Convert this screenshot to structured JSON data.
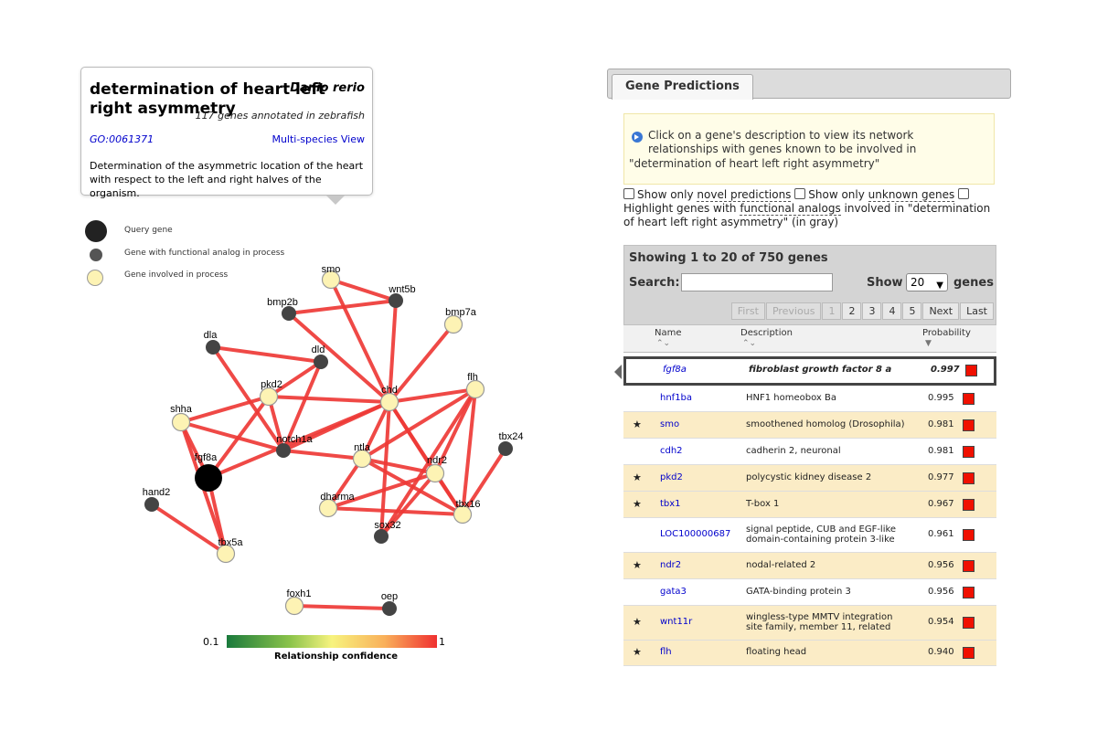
{
  "process": {
    "title": "determination of heart left right asymmetry",
    "species": "Danio rerio",
    "count_text": "117 genes annotated in zebrafish",
    "go_id": "GO:0061371",
    "multi_species": "Multi-species View",
    "description": "Determination of the asymmetric location of the heart with respect to the left and right halves of the organism."
  },
  "legend": {
    "query": "Query gene",
    "analog": "Gene with functional analog in process",
    "involved": "Gene involved in process"
  },
  "colors": {
    "query": "#000000",
    "analog": "#444444",
    "involved": "#fdf3b4",
    "edge": "#ee3a36",
    "prob_square": "#f01000"
  },
  "network": {
    "nodes": [
      {
        "id": "smo",
        "label": "smo",
        "type": "involved"
      },
      {
        "id": "wnt5b",
        "label": "wnt5b",
        "type": "analog"
      },
      {
        "id": "bmp2b",
        "label": "bmp2b",
        "type": "analog"
      },
      {
        "id": "bmp7a",
        "label": "bmp7a",
        "type": "involved"
      },
      {
        "id": "dla",
        "label": "dla",
        "type": "analog"
      },
      {
        "id": "dld",
        "label": "dld",
        "type": "analog"
      },
      {
        "id": "pkd2",
        "label": "pkd2",
        "type": "involved"
      },
      {
        "id": "chd",
        "label": "chd",
        "type": "involved"
      },
      {
        "id": "flh",
        "label": "flh",
        "type": "involved"
      },
      {
        "id": "shha",
        "label": "shha",
        "type": "involved"
      },
      {
        "id": "notch1a",
        "label": "notch1a",
        "type": "analog"
      },
      {
        "id": "ntla",
        "label": "ntla",
        "type": "involved"
      },
      {
        "id": "ndr2",
        "label": "ndr2",
        "type": "involved"
      },
      {
        "id": "tbx24",
        "label": "tbx24",
        "type": "analog"
      },
      {
        "id": "fgf8a",
        "label": "fgf8a",
        "type": "query"
      },
      {
        "id": "hand2",
        "label": "hand2",
        "type": "analog"
      },
      {
        "id": "dharma",
        "label": "dharma",
        "type": "involved"
      },
      {
        "id": "tbx16",
        "label": "tbx16",
        "type": "involved"
      },
      {
        "id": "sox32",
        "label": "sox32",
        "type": "analog"
      },
      {
        "id": "tbx5a",
        "label": "tbx5a",
        "type": "involved"
      },
      {
        "id": "foxh1",
        "label": "foxh1",
        "type": "involved"
      },
      {
        "id": "oep",
        "label": "oep",
        "type": "analog"
      }
    ],
    "edges": [
      [
        "smo",
        "wnt5b"
      ],
      [
        "smo",
        "chd"
      ],
      [
        "bmp2b",
        "wnt5b"
      ],
      [
        "wnt5b",
        "chd"
      ],
      [
        "bmp2b",
        "chd"
      ],
      [
        "bmp7a",
        "chd"
      ],
      [
        "dla",
        "dld"
      ],
      [
        "dla",
        "notch1a"
      ],
      [
        "dld",
        "pkd2"
      ],
      [
        "dld",
        "notch1a"
      ],
      [
        "pkd2",
        "chd"
      ],
      [
        "pkd2",
        "shha"
      ],
      [
        "pkd2",
        "fgf8a"
      ],
      [
        "pkd2",
        "notch1a"
      ],
      [
        "shha",
        "notch1a"
      ],
      [
        "shha",
        "fgf8a"
      ],
      [
        "shha",
        "tbx5a"
      ],
      [
        "chd",
        "flh"
      ],
      [
        "chd",
        "notch1a"
      ],
      [
        "chd",
        "ntla"
      ],
      [
        "chd",
        "ndr2"
      ],
      [
        "chd",
        "fgf8a"
      ],
      [
        "chd",
        "tbx16"
      ],
      [
        "chd",
        "sox32"
      ],
      [
        "flh",
        "ndr2"
      ],
      [
        "flh",
        "tbx16"
      ],
      [
        "flh",
        "ntla"
      ],
      [
        "flh",
        "sox32"
      ],
      [
        "ntla",
        "ndr2"
      ],
      [
        "ntla",
        "dharma"
      ],
      [
        "ntla",
        "tbx16"
      ],
      [
        "notch1a",
        "ntla"
      ],
      [
        "ndr2",
        "dharma"
      ],
      [
        "ndr2",
        "tbx16"
      ],
      [
        "ndr2",
        "sox32"
      ],
      [
        "tbx24",
        "tbx16"
      ],
      [
        "tbx16",
        "dharma"
      ],
      [
        "fgf8a",
        "tbx5a"
      ],
      [
        "hand2",
        "tbx5a"
      ],
      [
        "foxh1",
        "oep"
      ]
    ]
  },
  "scale": {
    "min": "0.1",
    "max": "1",
    "caption": "Relationship confidence"
  },
  "tabs": {
    "active": "Gene Predictions"
  },
  "info": {
    "line1": "Click on a gene's description to view its network relationships with genes known to be involved in",
    "line2": "\"determination of heart left right asymmetry\""
  },
  "filters": {
    "novel_prefix": "Show only ",
    "novel_link": "novel predictions",
    "unknown_prefix": "Show only ",
    "unknown_link": "unknown genes",
    "highlight_prefix": "Highlight genes with ",
    "highlight_link": "functional analogs",
    "highlight_suffix": " involved in \"determination of heart left right asymmetry\" (in gray)"
  },
  "table": {
    "showing": "Showing 1 to 20 of 750 genes",
    "search_label": "Search:",
    "search_value": "",
    "show_label": "Show",
    "page_size": "20",
    "genes_label": "genes",
    "pager": [
      "First",
      "Previous",
      "1",
      "2",
      "3",
      "4",
      "5",
      "Next",
      "Last"
    ],
    "columns": [
      "Name",
      "Description",
      "Probability"
    ],
    "rows": [
      {
        "star": "",
        "name": "fgf8a",
        "desc": "fibroblast growth factor 8 a",
        "prob": "0.997",
        "hl": false,
        "selected": true
      },
      {
        "star": "",
        "name": "hnf1ba",
        "desc": "HNF1 homeobox Ba",
        "prob": "0.995",
        "hl": false
      },
      {
        "star": "★",
        "name": "smo",
        "desc": "smoothened homolog (Drosophila)",
        "prob": "0.981",
        "hl": true
      },
      {
        "star": "",
        "name": "cdh2",
        "desc": "cadherin 2, neuronal",
        "prob": "0.981",
        "hl": false
      },
      {
        "star": "★",
        "name": "pkd2",
        "desc": "polycystic kidney disease 2",
        "prob": "0.977",
        "hl": true
      },
      {
        "star": "★",
        "name": "tbx1",
        "desc": "T-box 1",
        "prob": "0.967",
        "hl": true
      },
      {
        "star": "",
        "name": "LOC100000687",
        "desc": "signal peptide, CUB and EGF-like domain-containing protein 3-like",
        "prob": "0.961",
        "hl": false
      },
      {
        "star": "★",
        "name": "ndr2",
        "desc": "nodal-related 2",
        "prob": "0.956",
        "hl": true
      },
      {
        "star": "",
        "name": "gata3",
        "desc": "GATA-binding protein 3",
        "prob": "0.956",
        "hl": false
      },
      {
        "star": "★",
        "name": "wnt11r",
        "desc": "wingless-type MMTV integration site family, member 11, related",
        "prob": "0.954",
        "hl": true
      },
      {
        "star": "★",
        "name": "flh",
        "desc": "floating head",
        "prob": "0.940",
        "hl": true
      }
    ]
  }
}
